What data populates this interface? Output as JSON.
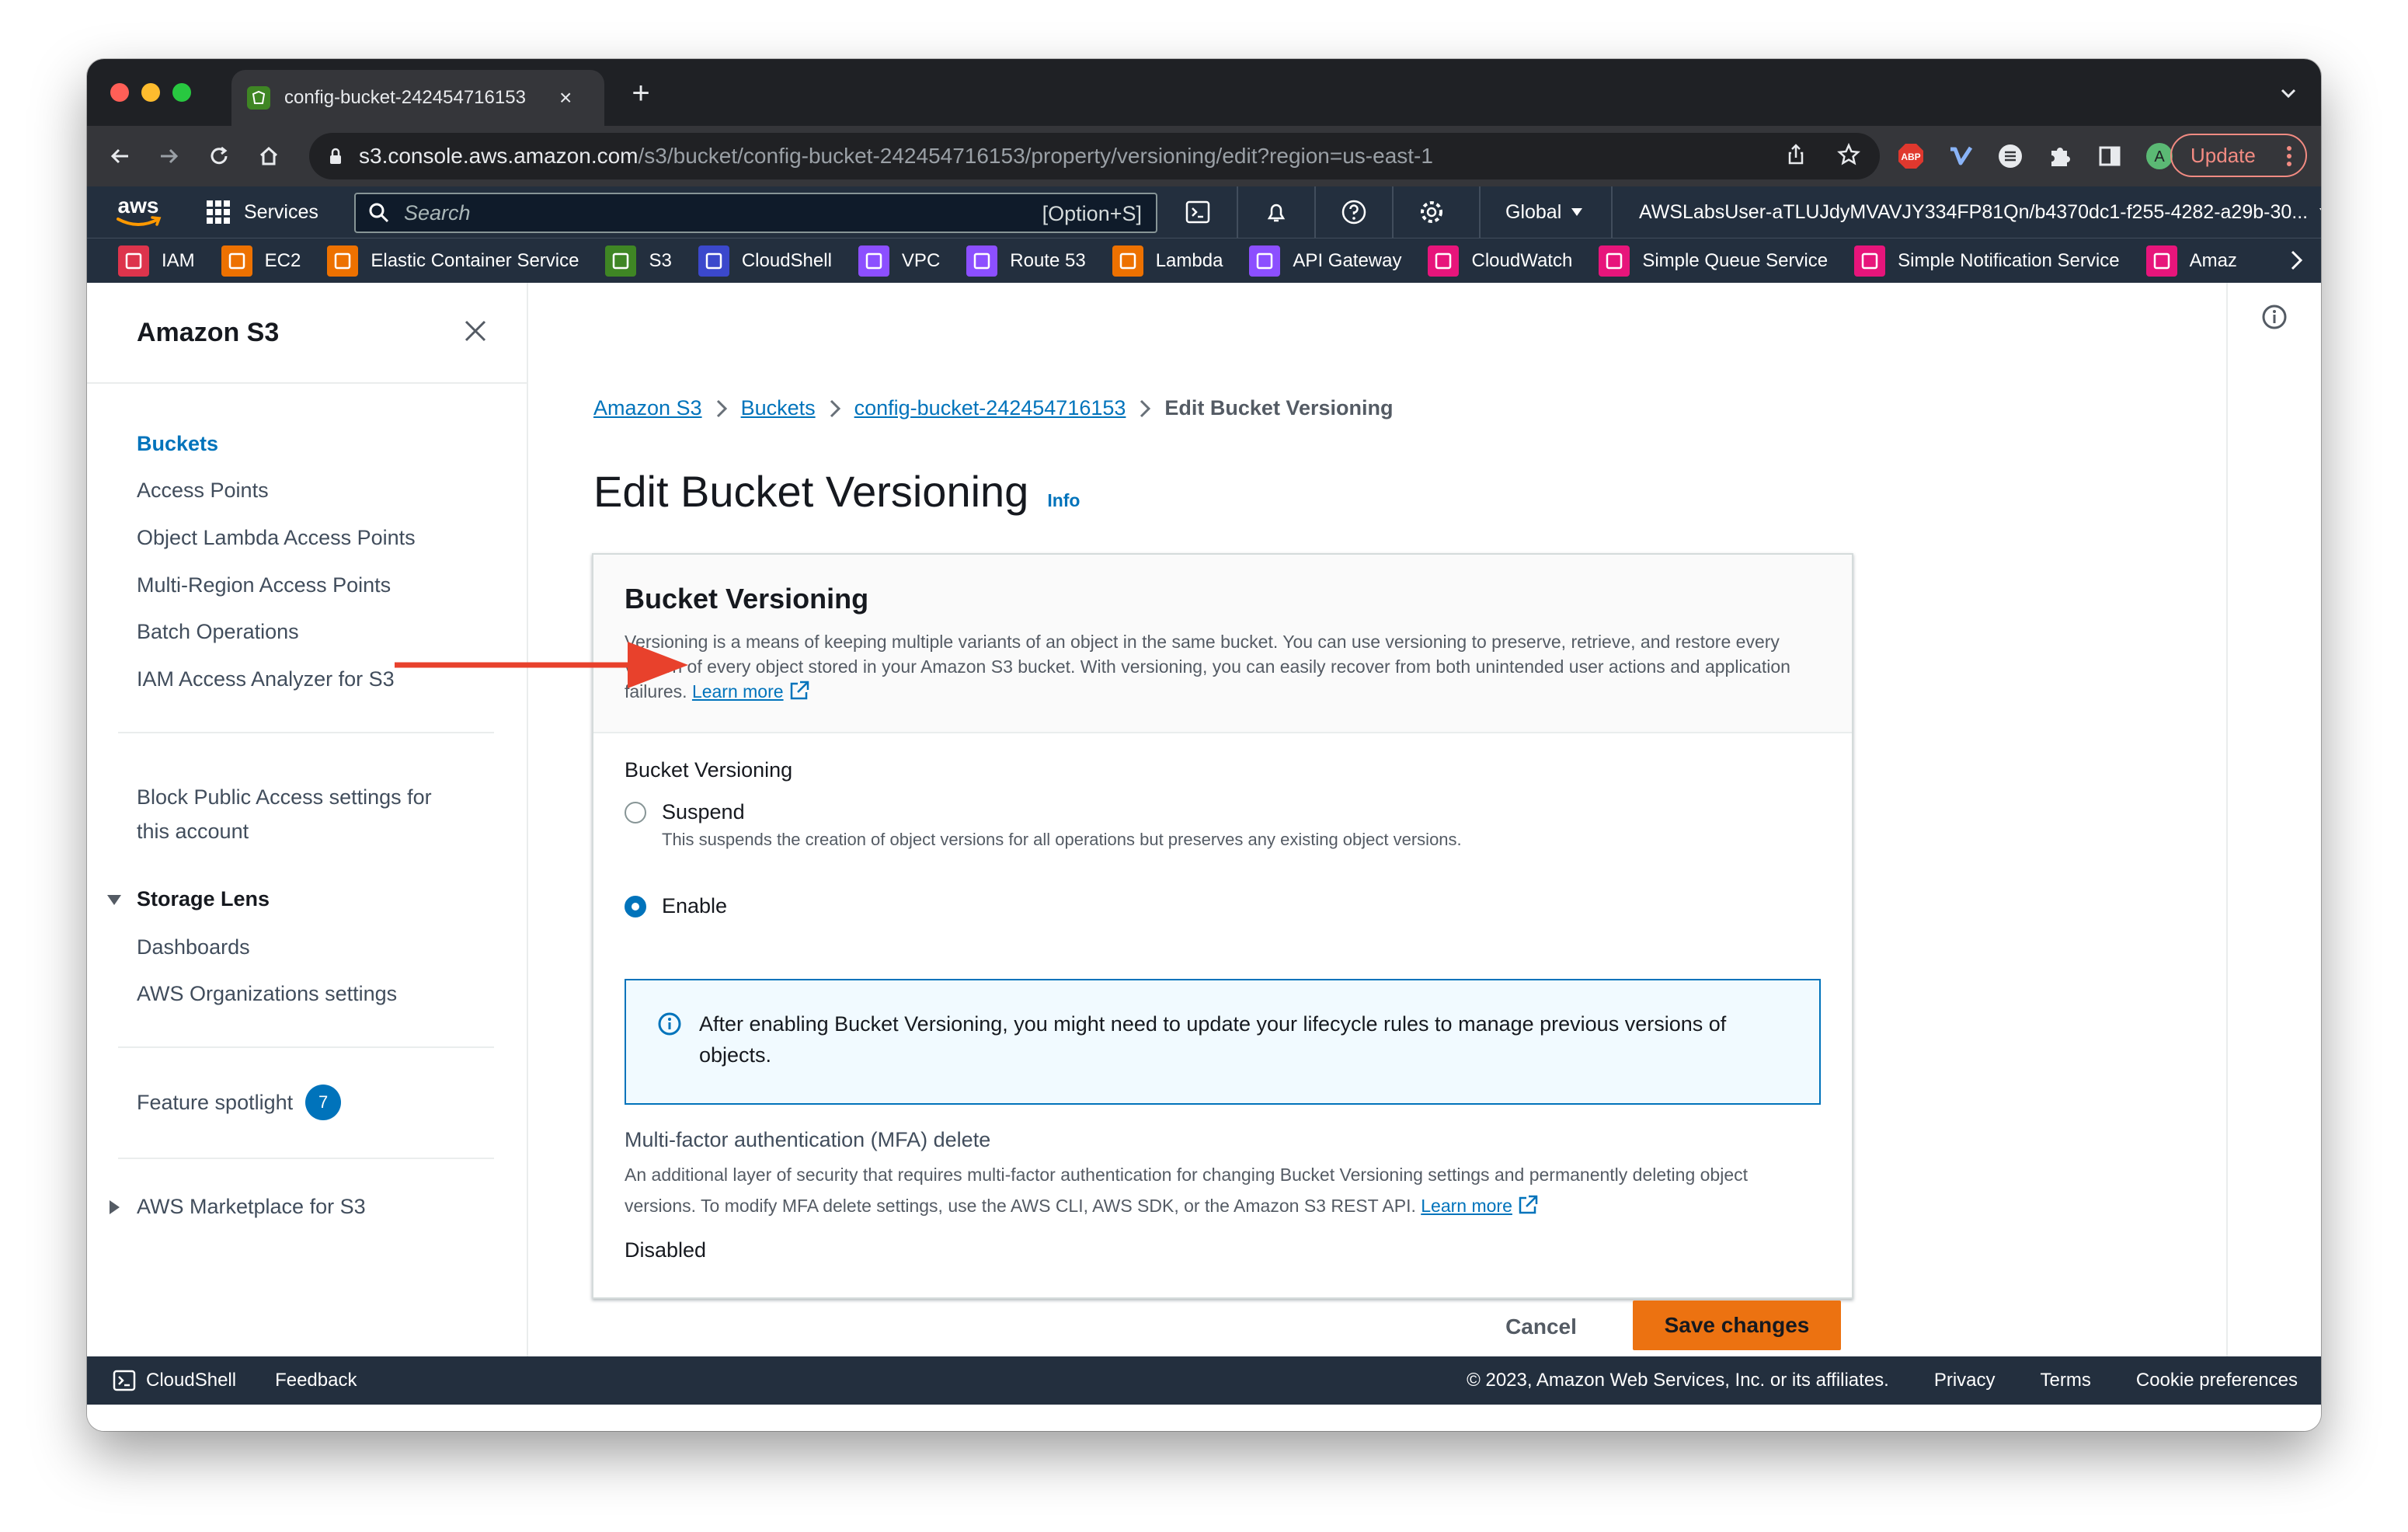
{
  "browser": {
    "tab_title": "config-bucket-242454716153",
    "url_host": "s3.console.aws.amazon.com",
    "url_path": "/s3/bucket/config-bucket-242454716153/property/versioning/edit?region=us-east-1",
    "update_label": "Update"
  },
  "aws_nav": {
    "logo_text": "aws",
    "services_label": "Services",
    "search_placeholder": "Search",
    "search_shortcut": "[Option+S]",
    "region_label": "Global",
    "account_label": "AWSLabsUser-aTLUJdyMVAVJY334FP81Qn/b4370dc1-f255-4282-a29b-30..."
  },
  "favorites": [
    {
      "label": "IAM",
      "color": "#dd344c"
    },
    {
      "label": "EC2",
      "color": "#ed7100"
    },
    {
      "label": "Elastic Container Service",
      "color": "#ed7100"
    },
    {
      "label": "S3",
      "color": "#3f8624"
    },
    {
      "label": "CloudShell",
      "color": "#3b48cc"
    },
    {
      "label": "VPC",
      "color": "#8c4fff"
    },
    {
      "label": "Route 53",
      "color": "#8c4fff"
    },
    {
      "label": "Lambda",
      "color": "#ed7100"
    },
    {
      "label": "API Gateway",
      "color": "#8c4fff"
    },
    {
      "label": "CloudWatch",
      "color": "#e7157b"
    },
    {
      "label": "Simple Queue Service",
      "color": "#e7157b"
    },
    {
      "label": "Simple Notification Service",
      "color": "#e7157b"
    },
    {
      "label": "Amaz",
      "color": "#e7157b"
    }
  ],
  "sidebar": {
    "title": "Amazon S3",
    "items": [
      "Buckets",
      "Access Points",
      "Object Lambda Access Points",
      "Multi-Region Access Points",
      "Batch Operations",
      "IAM Access Analyzer for S3"
    ],
    "block_public": "Block Public Access settings for this account",
    "storage_lens": "Storage Lens",
    "storage_lens_items": [
      "Dashboards",
      "AWS Organizations settings"
    ],
    "feature_spotlight": "Feature spotlight",
    "feature_spotlight_count": "7",
    "marketplace": "AWS Marketplace for S3"
  },
  "breadcrumbs": [
    "Amazon S3",
    "Buckets",
    "config-bucket-242454716153",
    "Edit Bucket Versioning"
  ],
  "page": {
    "title": "Edit Bucket Versioning",
    "info": "Info"
  },
  "panel": {
    "title": "Bucket Versioning",
    "description": "Versioning is a means of keeping multiple variants of an object in the same bucket. You can use versioning to preserve, retrieve, and restore every version of every object stored in your Amazon S3 bucket. With versioning, you can easily recover from both unintended user actions and application failures.",
    "learn_more": "Learn more",
    "field_label": "Bucket Versioning",
    "suspend_label": "Suspend",
    "suspend_desc": "This suspends the creation of object versions for all operations but preserves any existing object versions.",
    "enable_label": "Enable",
    "selected": "Enable",
    "alert": "After enabling Bucket Versioning, you might need to update your lifecycle rules to manage previous versions of objects.",
    "mfa_title": "Multi-factor authentication (MFA) delete",
    "mfa_desc": "An additional layer of security that requires multi-factor authentication for changing Bucket Versioning settings and permanently deleting object versions. To modify MFA delete settings, use the AWS CLI, AWS SDK, or the Amazon S3 REST API.",
    "mfa_learn_more": "Learn more",
    "mfa_value": "Disabled"
  },
  "actions": {
    "cancel": "Cancel",
    "save": "Save changes"
  },
  "footer": {
    "cloudshell": "CloudShell",
    "feedback": "Feedback",
    "copyright": "© 2023, Amazon Web Services, Inc. or its affiliates.",
    "privacy": "Privacy",
    "terms": "Terms",
    "cookies": "Cookie preferences"
  },
  "colors": {
    "aws_nav": "#232f3e",
    "link": "#0073bb",
    "primary_button": "#ec7211",
    "annotation_arrow": "#e8412c"
  }
}
